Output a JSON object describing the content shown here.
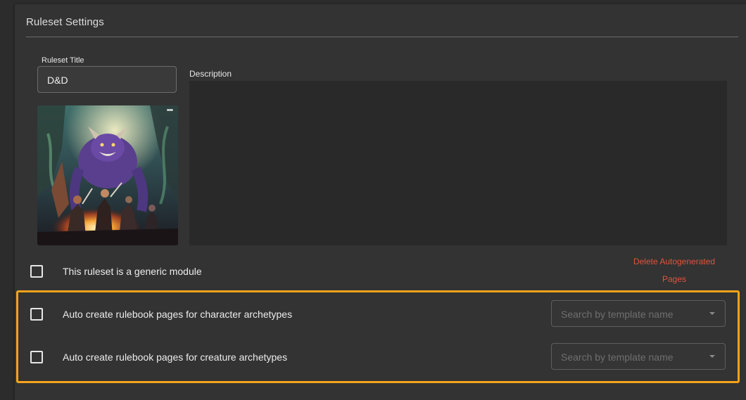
{
  "panel": {
    "title": "Ruleset Settings"
  },
  "ruleset_title": {
    "label": "Ruleset Title",
    "value": "D&D"
  },
  "description": {
    "label": "Description",
    "value": ""
  },
  "image": {
    "menu_icon": "more-horizontal-icon"
  },
  "generic_module": {
    "label": "This ruleset is a generic module",
    "checked": false
  },
  "delete_autogenerated": {
    "label_line1": "Delete Autogenerated",
    "label_line2": "Pages"
  },
  "auto_create": [
    {
      "label": "Auto create rulebook pages for character archetypes",
      "checked": false,
      "template_placeholder": "Search by template name"
    },
    {
      "label": "Auto create rulebook pages for creature archetypes",
      "checked": false,
      "template_placeholder": "Search by template name"
    }
  ],
  "colors": {
    "accent_highlight": "#f5a31a",
    "danger": "#e0533d",
    "panel_bg": "#333333"
  }
}
